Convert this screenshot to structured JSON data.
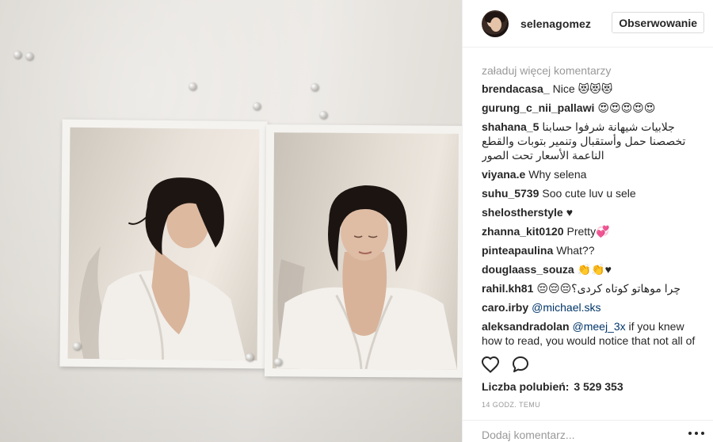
{
  "post": {
    "username": "selenagomez",
    "follow_label": "Obserwowanie"
  },
  "comments": {
    "load_more": "załaduj więcej komentarzy",
    "items": [
      {
        "user": "brendacasa_",
        "text": "Nice 😻😻😻"
      },
      {
        "user": "gurung_c_nii_pallawi",
        "text": "😍😍😍😍😍"
      },
      {
        "user": "shahana_5",
        "text": "جلابيات شيهانة شرفوا حسابنا تخصصنا حمل وأستقبال وتنمير بتوبات والقطع الناعمة الأسعار تحت الصور"
      },
      {
        "user": "viyana.e",
        "text": "Why selena"
      },
      {
        "user": "suhu_5739",
        "text": "Soo cute luv u sele"
      },
      {
        "user": "shelostherstyle",
        "text": "♥"
      },
      {
        "user": "zhanna_kit0120",
        "text": "Pretty💞"
      },
      {
        "user": "pinteapaulina",
        "text": "What??"
      },
      {
        "user": "douglaass_souza",
        "text": "👏👏♥"
      },
      {
        "user": "rahil.kh81",
        "text": "چرا موهاتو کوتاه کردی؟😔😔😔"
      },
      {
        "user": "caro.irby",
        "mention": "@michael.sks",
        "text": ""
      },
      {
        "user": "aleksandradolan",
        "mention": "@meej_3x",
        "text": "if you knew how to read, you would notice that not all of the people said she's pretty. And why do"
      }
    ]
  },
  "actions": {
    "like_icon": "heart-icon",
    "comment_icon": "comment-bubble-icon"
  },
  "likes": {
    "label": "Liczba polubień:",
    "count": "3 529 353"
  },
  "timestamp": "14 GODZ. TEMU",
  "add_comment": {
    "placeholder": "Dodaj komentarz..."
  },
  "colors": {
    "text": "#262626",
    "muted": "#999999",
    "mention": "#003569",
    "border": "#efefef"
  }
}
